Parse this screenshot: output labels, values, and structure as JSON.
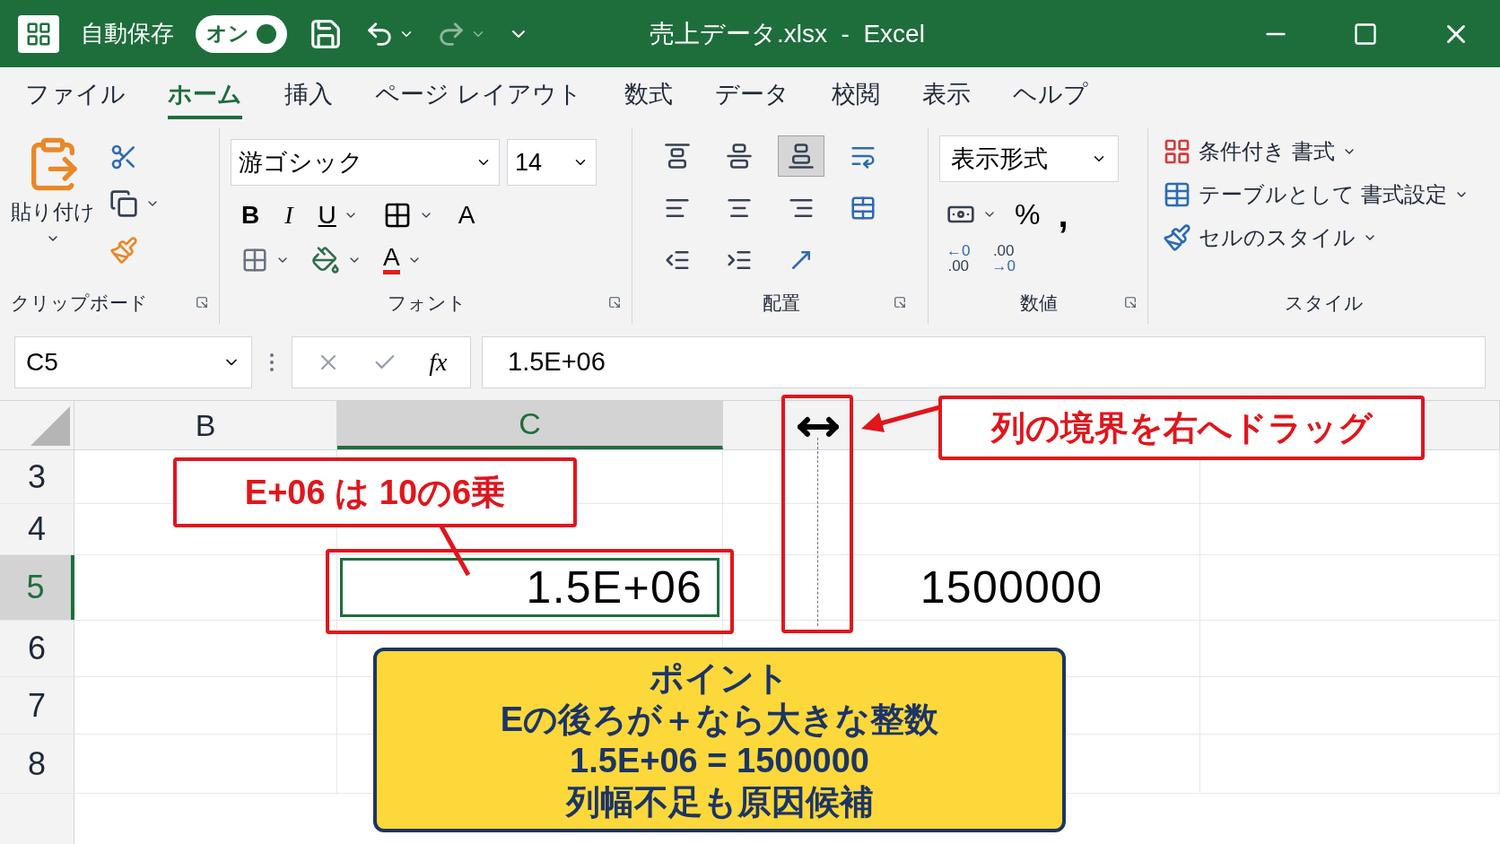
{
  "title_bar": {
    "autosave_label": "自動保存",
    "autosave": {
      "label": "オン",
      "on": true
    },
    "title": "売上データ.xlsx  -  Excel"
  },
  "tabs": [
    {
      "label": "ファイル",
      "selected": false
    },
    {
      "label": "ホーム",
      "selected": true
    },
    {
      "label": "挿入",
      "selected": false
    },
    {
      "label": "ページ レイアウト",
      "selected": false
    },
    {
      "label": "数式",
      "selected": false
    },
    {
      "label": "データ",
      "selected": false
    },
    {
      "label": "校閲",
      "selected": false
    },
    {
      "label": "表示",
      "selected": false
    },
    {
      "label": "ヘルプ",
      "selected": false
    }
  ],
  "ribbon": {
    "clipboard": {
      "paste_label": "貼り付け",
      "group_label": "クリップボード"
    },
    "font": {
      "font_name": "游ゴシック",
      "font_size": "14",
      "bold": "B",
      "italic": "I",
      "underline": "U",
      "grow": "A",
      "font_color": "A",
      "group_label": "フォント"
    },
    "alignment": {
      "buttons": [
        {
          "kind": "top",
          "selected": false
        },
        {
          "kind": "middle",
          "selected": false
        },
        {
          "kind": "bottom",
          "selected": true
        },
        {
          "kind": "wrap",
          "selected": false
        },
        {
          "kind": "left",
          "selected": false
        },
        {
          "kind": "center",
          "selected": false
        },
        {
          "kind": "right",
          "selected": false
        },
        {
          "kind": "merge",
          "selected": false
        },
        {
          "kind": "outdent",
          "selected": false
        },
        {
          "kind": "indent",
          "selected": false
        },
        {
          "kind": "orientation",
          "selected": false
        }
      ],
      "group_label": "配置"
    },
    "number": {
      "format": "表示形式",
      "percent": "%",
      "comma": ",",
      "increase_top": "←0",
      "increase_bottom": ".00",
      "decrease_top": ".00",
      "decrease_bottom": "→0",
      "group_label": "数値"
    },
    "styles": {
      "items": [
        "条件付き 書式",
        "テーブルとして 書式設定",
        "セルのスタイル"
      ],
      "group_label": "スタイル"
    }
  },
  "formula_bar": {
    "name_box": "C5",
    "fx": "fx",
    "value": "1.5E+06"
  },
  "sheet": {
    "columns": [
      {
        "label": "B",
        "selected": false
      },
      {
        "label": "C",
        "selected": true
      }
    ],
    "rows": [
      {
        "label": "3",
        "selected": false
      },
      {
        "label": "4",
        "selected": false
      },
      {
        "label": "5",
        "selected": true,
        "cells": [
          null,
          {
            "value": "1.5E+06",
            "selected": true
          },
          {
            "value": "1500000",
            "selected": false
          },
          null
        ]
      },
      {
        "label": "6",
        "selected": false
      },
      {
        "label": "7",
        "selected": false
      },
      {
        "label": "8",
        "selected": false
      }
    ]
  },
  "annotations": {
    "exponent_callout": "E+06 は 10の6乗",
    "drag_callout": "列の境界を右へドラッグ",
    "note": [
      "ポイント",
      "Eの後ろが＋なら大きな整数",
      "1.5E+06 = 1500000",
      "列幅不足も原因候補"
    ]
  }
}
